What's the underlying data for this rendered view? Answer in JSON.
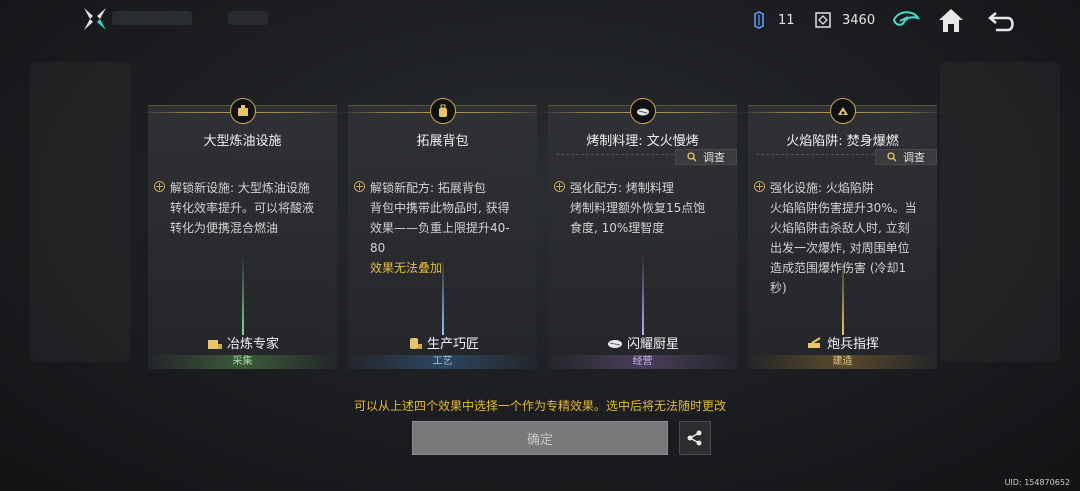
{
  "topbar": {
    "res1_value": "11",
    "res2_value": "3460",
    "icons": [
      "logo-icon",
      "crystal-icon",
      "token-icon",
      "faction-icon",
      "home-icon",
      "back-icon"
    ]
  },
  "cards": [
    {
      "title": "大型炼油设施",
      "icon": "oil-refinery-icon",
      "has_inspect": false,
      "body_lines": [
        "解锁新设施: 大型炼油设施",
        "转化效率提升。可以将酸液",
        "转化为便携混合燃油"
      ],
      "note": "",
      "role": "冶炼专家",
      "band": "采集",
      "band_color": "#3c5a3a",
      "glow_color": "#7bd6a0"
    },
    {
      "title": "拓展背包",
      "icon": "backpack-icon",
      "has_inspect": false,
      "body_lines": [
        "解锁新配方: 拓展背包",
        "背包中携带此物品时, 获得",
        "效果——负重上限提升40-",
        "80"
      ],
      "note": "效果无法叠加",
      "role": "生产巧匠",
      "band": "工艺",
      "band_color": "#2d4660",
      "glow_color": "#8fc3ff"
    },
    {
      "title": "烤制料理: 文火慢烤",
      "icon": "cooking-icon",
      "has_inspect": true,
      "inspect_label": "调查",
      "body_lines": [
        "强化配方: 烤制料理",
        "烤制料理额外恢复15点饱",
        "食度, 10%理智度"
      ],
      "note": "",
      "role": "闪耀厨星",
      "band": "经营",
      "band_color": "#4a3e5c",
      "glow_color": "#c6a6ff"
    },
    {
      "title": "火焰陷阱: 焚身爆燃",
      "icon": "trap-icon",
      "has_inspect": true,
      "inspect_label": "调查",
      "body_lines": [
        "强化设施: 火焰陷阱",
        "火焰陷阱伤害提升30%。当",
        "火焰陷阱击杀敌人时, 立刻",
        "出发一次爆炸, 对周围单位",
        "造成范围爆炸伤害 (冷却1",
        "秒)"
      ],
      "note": "",
      "role": "炮兵指挥",
      "band": "建造",
      "band_color": "#5a4a2a",
      "glow_color": "#e8c56a"
    }
  ],
  "hint": "可以从上述四个效果中选择一个作为专精效果。选中后将无法随时更改",
  "confirm_label": "确定",
  "uid": "UID: 154870652"
}
